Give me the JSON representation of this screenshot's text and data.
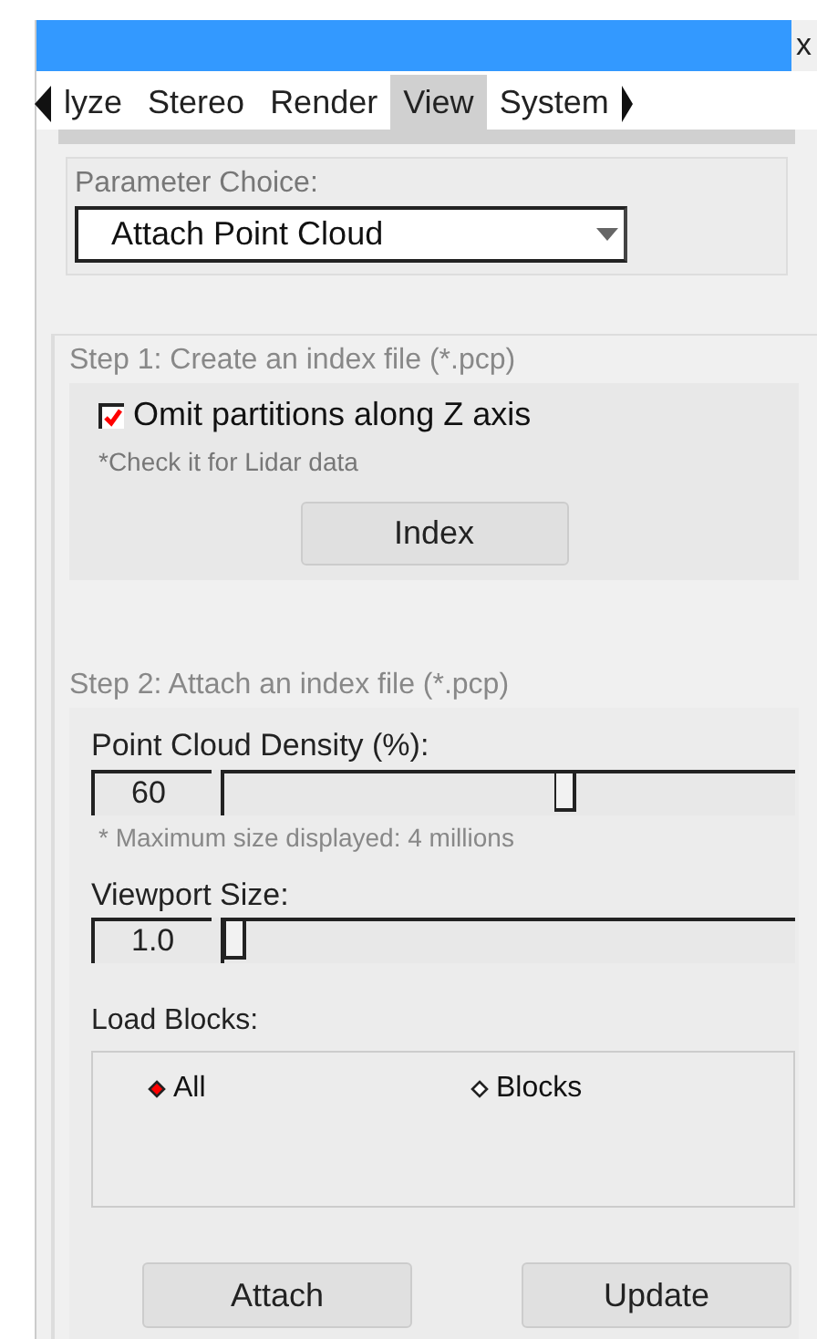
{
  "window": {
    "close": "x"
  },
  "tabs": [
    {
      "label": "lyze",
      "selected": false
    },
    {
      "label": "Stereo",
      "selected": false
    },
    {
      "label": "Render",
      "selected": false
    },
    {
      "label": "View",
      "selected": true
    },
    {
      "label": "System",
      "selected": false
    }
  ],
  "parameter_choice": {
    "label": "Parameter Choice:",
    "value": "Attach Point Cloud"
  },
  "step1": {
    "title": "Step 1: Create an index file (*.pcp)",
    "checkbox": {
      "label": "Omit partitions along Z axis",
      "checked": true
    },
    "hint": "*Check it for Lidar data",
    "button": "Index"
  },
  "step2": {
    "title": "Step 2: Attach an index file (*.pcp)",
    "sliders": [
      {
        "label": "Point Cloud Density (%):",
        "value": "60",
        "level": 0.6,
        "note": "* Maximum size displayed: 4 millions"
      },
      {
        "label": "Viewport Size:",
        "value": "1.0",
        "level": 0
      }
    ],
    "load_blocks": {
      "label": "Load Blocks:",
      "options": [
        {
          "label": "All",
          "selected": true
        },
        {
          "label": "Blocks",
          "selected": false
        }
      ]
    },
    "buttons": [
      "Attach",
      "Update"
    ]
  }
}
